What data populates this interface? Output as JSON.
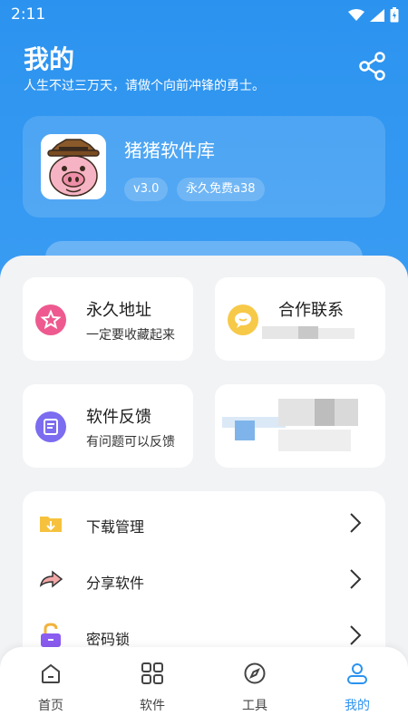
{
  "status_bar": {
    "time": "2:11"
  },
  "header": {
    "title": "我的",
    "subtitle": "人生不过三万天，请做个向前冲锋的勇士。",
    "share_icon": "share-icon"
  },
  "profile": {
    "app_name": "猪猪软件库",
    "version_tag": "v3.0",
    "free_tag": "永久免费a38"
  },
  "tiles": [
    {
      "title": "永久地址",
      "subtitle": "一定要收藏起来",
      "icon": "star-badge-icon",
      "color": "#ee5a8f"
    },
    {
      "title": "合作联系",
      "subtitle": "",
      "icon": "chat-bubble-icon",
      "color": "#f7c948"
    },
    {
      "title": "软件反馈",
      "subtitle": "有问题可以反馈",
      "icon": "feedback-icon",
      "color": "#7b6cf0"
    }
  ],
  "menu": [
    {
      "label": "下载管理",
      "icon": "download-folder-icon"
    },
    {
      "label": "分享软件",
      "icon": "share-arrow-icon"
    },
    {
      "label": "密码锁",
      "icon": "padlock-icon"
    }
  ],
  "tabbar": [
    {
      "label": "首页",
      "icon": "home-icon"
    },
    {
      "label": "软件",
      "icon": "grid-icon"
    },
    {
      "label": "工具",
      "icon": "compass-icon"
    },
    {
      "label": "我的",
      "icon": "user-icon",
      "active": true
    }
  ],
  "colors": {
    "primary": "#2b93ef",
    "background": "#f3f4f6"
  }
}
